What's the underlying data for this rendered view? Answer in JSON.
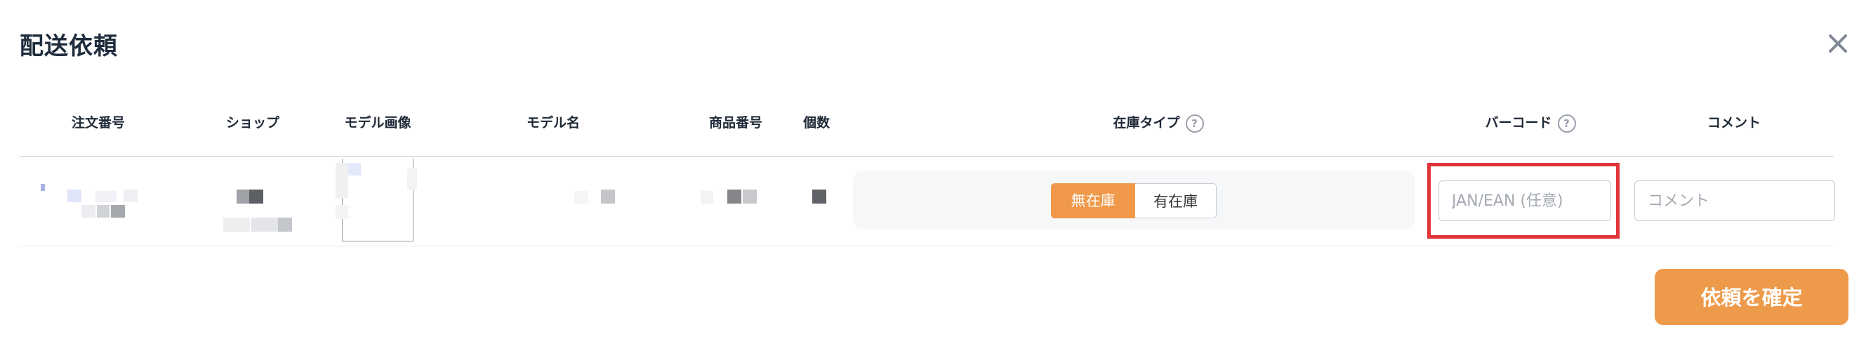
{
  "dialog": {
    "title": "配送依頼"
  },
  "table": {
    "headers": {
      "order_no": "注文番号",
      "shop": "ショップ",
      "model_image": "モデル画像",
      "model_name": "モデル名",
      "product_no": "商品番号",
      "quantity": "個数",
      "stock_type": "在庫タイプ",
      "barcode": "バーコード",
      "comment": "コメント"
    },
    "row": {
      "stock_options": [
        "無在庫",
        "有在庫"
      ],
      "stock_selected": "無在庫",
      "barcode_placeholder": "JAN/EAN (任意)",
      "comment_placeholder": "コメント"
    }
  },
  "footer": {
    "confirm_label": "依頼を確定"
  },
  "icons": {
    "close": "close-icon",
    "help": "help-circle-icon"
  },
  "colors": {
    "accent": "#f0994a",
    "highlight": "#e0343a",
    "text": "#1f2937"
  }
}
